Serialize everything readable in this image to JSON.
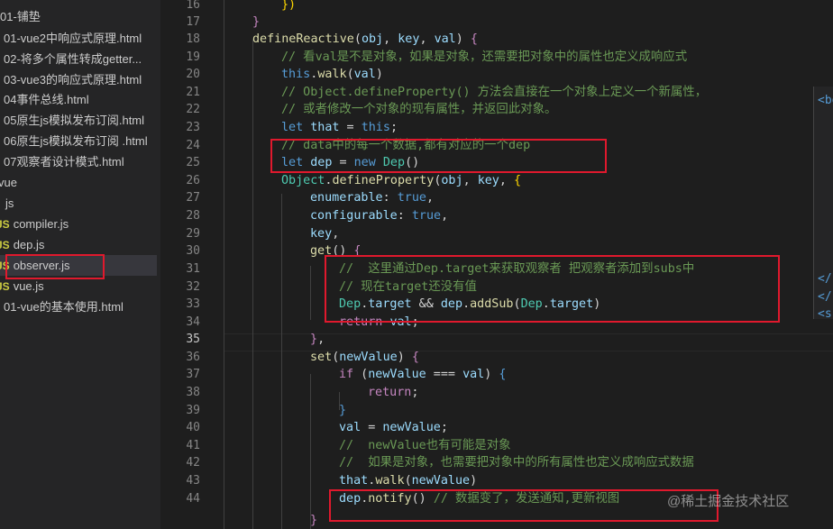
{
  "explorer": {
    "items": [
      {
        "label": "01-铺垫"
      },
      {
        "label": "01-vue2中响应式原理.html"
      },
      {
        "label": "02-将多个属性转成getter..."
      },
      {
        "label": "03-vue3的响应式原理.html"
      },
      {
        "label": "04事件总线.html"
      },
      {
        "label": "05原生js模拟发布订阅.html"
      },
      {
        "label": "06原生js模拟发布订阅 .html"
      },
      {
        "label": "07观察者设计模式.html"
      },
      {
        "label": "vue"
      },
      {
        "label": "js"
      },
      {
        "label": "compiler.js",
        "badge": "JS"
      },
      {
        "label": "dep.js",
        "badge": "JS"
      },
      {
        "label": "observer.js",
        "badge": "JS"
      },
      {
        "label": "vue.js",
        "badge": "JS"
      },
      {
        "label": "01-vue的基本使用.html"
      }
    ]
  },
  "editor": {
    "line_numbers": [
      "16",
      "17",
      "18",
      "19",
      "20",
      "21",
      "22",
      "23",
      "24",
      "25",
      "26",
      "27",
      "28",
      "29",
      "30",
      "31",
      "32",
      "33",
      "34",
      "35",
      "36",
      "37",
      "38",
      "39",
      "40",
      "41",
      "42",
      "43",
      "44"
    ],
    "active_line": "35"
  },
  "peek": {
    "fragments": [
      "<bo",
      "</",
      "</",
      "<s"
    ]
  },
  "watermark": "@稀土掘金技术社区",
  "colors": {
    "keyword": "#569cd6",
    "comment": "#6a9955",
    "function": "#dcdcaa",
    "variable": "#9cdcfe",
    "class": "#4ec9b0",
    "highlight_box": "#e0192d"
  }
}
